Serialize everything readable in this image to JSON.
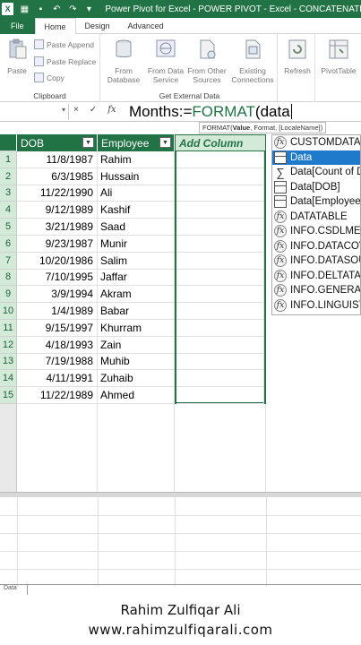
{
  "titlebar": {
    "app_icon_label": "X",
    "title": "Power Pivot for Excel - POWER PIVOT - Excel - CONCATENATE..."
  },
  "tabs": [
    "File",
    "Home",
    "Design",
    "Advanced"
  ],
  "ribbon": {
    "clipboard": {
      "paste": "Paste",
      "paste_append": "Paste Append",
      "paste_replace": "Paste Replace",
      "copy": "Copy",
      "group_label": "Clipboard"
    },
    "external": {
      "from_database": [
        "From",
        "Database"
      ],
      "from_data_service": [
        "From Data",
        "Service"
      ],
      "from_other_sources": [
        "From Other",
        "Sources"
      ],
      "existing_connections": [
        "Existing",
        "Connections"
      ],
      "group_label": "Get External Data"
    },
    "refresh": "Refresh",
    "pivottable": "PivotTable"
  },
  "formula_bar": {
    "cancel": "×",
    "enter": "✓",
    "fx": "fx",
    "prefix": "Months:=",
    "function": "FORMAT",
    "suffix": "(data",
    "tooltip_prefix": "FORMAT(",
    "tooltip_bold": "Value",
    "tooltip_rest": ", Format, [LocaleName])"
  },
  "table": {
    "columns": [
      "DOB",
      "Employee",
      "Add Column"
    ],
    "rows": [
      {
        "n": "1",
        "dob": "11/8/1987",
        "employee": "Rahim"
      },
      {
        "n": "2",
        "dob": "6/3/1985",
        "employee": "Hussain"
      },
      {
        "n": "3",
        "dob": "11/22/1990",
        "employee": "Ali"
      },
      {
        "n": "4",
        "dob": "9/12/1989",
        "employee": "Kashif"
      },
      {
        "n": "5",
        "dob": "3/21/1989",
        "employee": "Saad"
      },
      {
        "n": "6",
        "dob": "9/23/1987",
        "employee": "Munir"
      },
      {
        "n": "7",
        "dob": "10/20/1986",
        "employee": "Salim"
      },
      {
        "n": "8",
        "dob": "7/10/1995",
        "employee": "Jaffar"
      },
      {
        "n": "9",
        "dob": "3/9/1994",
        "employee": "Akram"
      },
      {
        "n": "10",
        "dob": "1/4/1989",
        "employee": "Babar"
      },
      {
        "n": "11",
        "dob": "9/15/1997",
        "employee": "Khurram"
      },
      {
        "n": "12",
        "dob": "4/18/1993",
        "employee": "Zain"
      },
      {
        "n": "13",
        "dob": "7/19/1988",
        "employee": "Muhib"
      },
      {
        "n": "14",
        "dob": "4/11/1991",
        "employee": "Zuhaib"
      },
      {
        "n": "15",
        "dob": "11/22/1989",
        "employee": "Ahmed"
      }
    ]
  },
  "autocomplete": [
    {
      "icon": "function",
      "label": "CUSTOMDATA",
      "selected": false
    },
    {
      "icon": "table",
      "label": "Data",
      "selected": true
    },
    {
      "icon": "sum",
      "label": "Data[Count of DOB]",
      "selected": false
    },
    {
      "icon": "table",
      "label": "Data[DOB]",
      "selected": false
    },
    {
      "icon": "table",
      "label": "Data[Employee]",
      "selected": false
    },
    {
      "icon": "function",
      "label": "DATATABLE",
      "selected": false
    },
    {
      "icon": "function",
      "label": "INFO.CSDLMETADATA",
      "selected": false
    },
    {
      "icon": "function",
      "label": "INFO.DATACOVERAGEDEFINITIONS",
      "selected": false
    },
    {
      "icon": "function",
      "label": "INFO.DATASOURCES",
      "selected": false
    },
    {
      "icon": "function",
      "label": "INFO.DELTATABLEMETADATA",
      "selected": false
    },
    {
      "icon": "function",
      "label": "INFO.GENERALSEGMENTMAPSEGMENTMETADATASTORAGES",
      "selected": false
    },
    {
      "icon": "function",
      "label": "INFO.LINGUISTICMETADATA",
      "selected": false
    }
  ],
  "sheet_tab": "Data",
  "watermark": {
    "name": "Rahim Zulfiqar Ali",
    "url": "www.rahimzulfiqarali.com"
  },
  "colors": {
    "excel_green": "#217346",
    "selection_blue": "#1f7acb",
    "add_column_fill": "#d3ead9"
  }
}
